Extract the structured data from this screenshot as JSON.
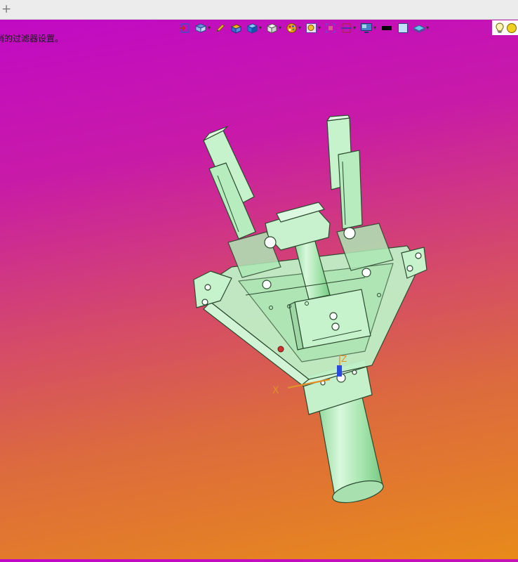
{
  "tabstrip": {
    "add_tab_glyph": "+"
  },
  "status": {
    "message": "消的过滤器设置。"
  },
  "toolbar": {
    "items": [
      {
        "icon": "sketch-exit-icon",
        "has_menu": false
      },
      {
        "icon": "view-orient-icon",
        "has_menu": true
      },
      {
        "icon": "pencil-icon",
        "has_menu": false
      },
      {
        "icon": "box-material-icon",
        "has_menu": false
      },
      {
        "icon": "cube-shaded-icon",
        "has_menu": true
      },
      {
        "icon": "cube-wire-icon",
        "has_menu": true
      },
      {
        "icon": "color-palette-icon",
        "has_menu": true
      },
      {
        "icon": "zoom-icon",
        "has_menu": true
      },
      {
        "icon": "fit-view-icon",
        "has_menu": false
      },
      {
        "icon": "section-view-icon",
        "has_menu": true
      },
      {
        "icon": "display-monitor-icon",
        "has_menu": true
      },
      {
        "icon": "black-rect-icon",
        "has_menu": false
      },
      {
        "icon": "light-square-icon",
        "has_menu": false
      },
      {
        "icon": "layer-icon",
        "has_menu": true
      }
    ],
    "right": {
      "icons": [
        "lightbulb-icon",
        "lightbulb-filled-icon"
      ]
    }
  },
  "triad": {
    "x_label": "X",
    "z_label": "Z"
  },
  "colors": {
    "bg_top": "#c008c8",
    "bg_bottom": "#e88a1a",
    "part_fill": "#b4ecbc",
    "part_edge": "#2b4a2e",
    "axis_orange": "#e0902a"
  }
}
